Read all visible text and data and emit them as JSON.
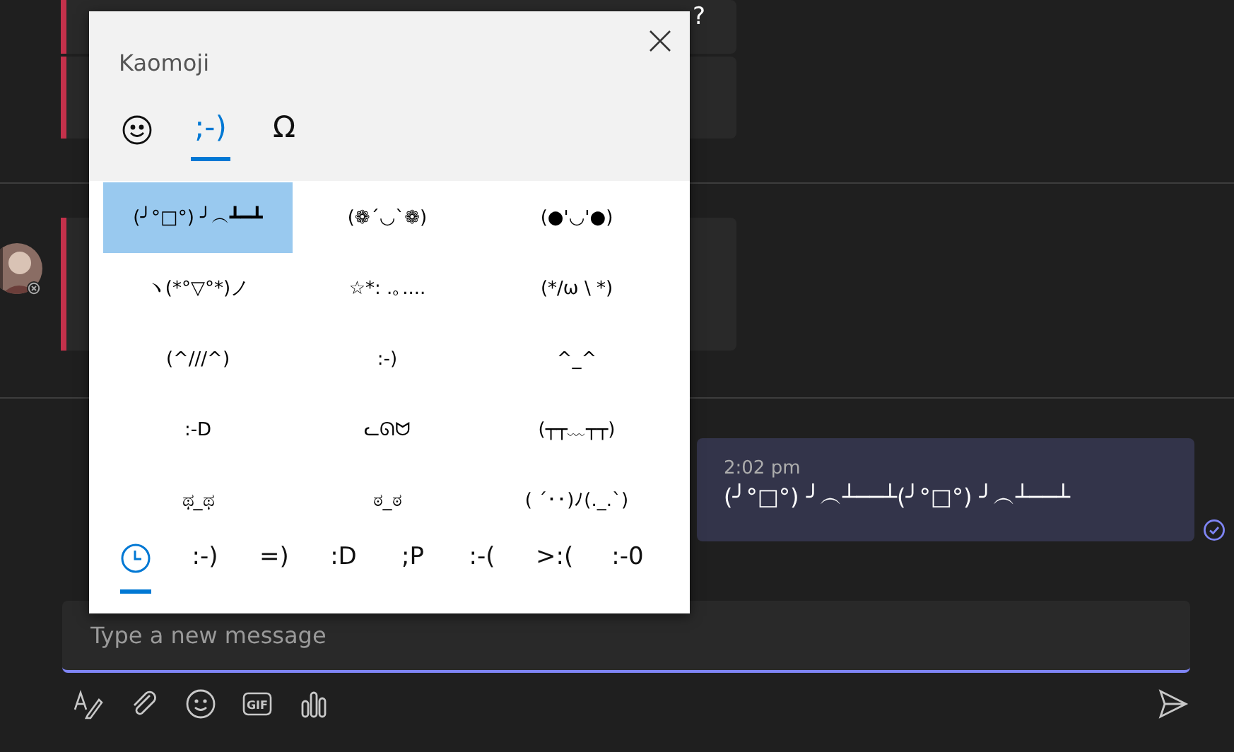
{
  "chat": {
    "top_message": {
      "text": "?"
    },
    "sent": {
      "time": "2:02 pm",
      "text": "(╯°□°) ╯︵┴──┴(╯°□°) ╯︵┴──┴"
    }
  },
  "compose": {
    "placeholder": "Type a new message"
  },
  "toolbar": [
    {
      "kind": "format"
    },
    {
      "kind": "attach"
    },
    {
      "kind": "emoji"
    },
    {
      "kind": "gif",
      "label": "GIF"
    },
    {
      "kind": "poll"
    }
  ],
  "picker": {
    "title": "Kaomoji",
    "tabs": [
      {
        "kind": "emoji",
        "selected": false
      },
      {
        "kind": "text",
        "label": ";-)",
        "selected": true
      },
      {
        "kind": "text",
        "label": "Ω",
        "selected": false
      }
    ],
    "items": [
      {
        "text": "(╯°□°) ╯︵┻━┻",
        "selected": true
      },
      {
        "text": "(❁´◡`❁)",
        "selected": false
      },
      {
        "text": "(●'◡'●)",
        "selected": false
      },
      {
        "text": "ヽ(*°▽°*)ノ",
        "selected": false
      },
      {
        "text": "☆*: .｡....",
        "selected": false
      },
      {
        "text": "(*/ω \\ *)",
        "selected": false
      },
      {
        "text": "(^///^)",
        "selected": false
      },
      {
        "text": ":-)",
        "selected": false
      },
      {
        "text": "^_^",
        "selected": false
      },
      {
        "text": ":-D",
        "selected": false
      },
      {
        "text": "ᓚᘏᗢ",
        "selected": false
      },
      {
        "text": "(┬┬﹏┬┬)",
        "selected": false
      },
      {
        "text": "ಥ_ಥ",
        "selected": false
      },
      {
        "text": "ಠ_ಠ",
        "selected": false
      },
      {
        "text": "( ´･･)ﾉ(._.`)",
        "selected": false
      }
    ],
    "categories": [
      {
        "kind": "recent",
        "selected": true
      },
      {
        "kind": "text",
        "label": ":-)",
        "selected": false
      },
      {
        "kind": "text",
        "label": "=)",
        "selected": false
      },
      {
        "kind": "text",
        "label": ":D",
        "selected": false
      },
      {
        "kind": "text",
        "label": ";P",
        "selected": false
      },
      {
        "kind": "text",
        "label": ":-(",
        "selected": false
      },
      {
        "kind": "text",
        "label": ">:(",
        "selected": false
      },
      {
        "kind": "text",
        "label": ":-0",
        "selected": false
      }
    ]
  }
}
